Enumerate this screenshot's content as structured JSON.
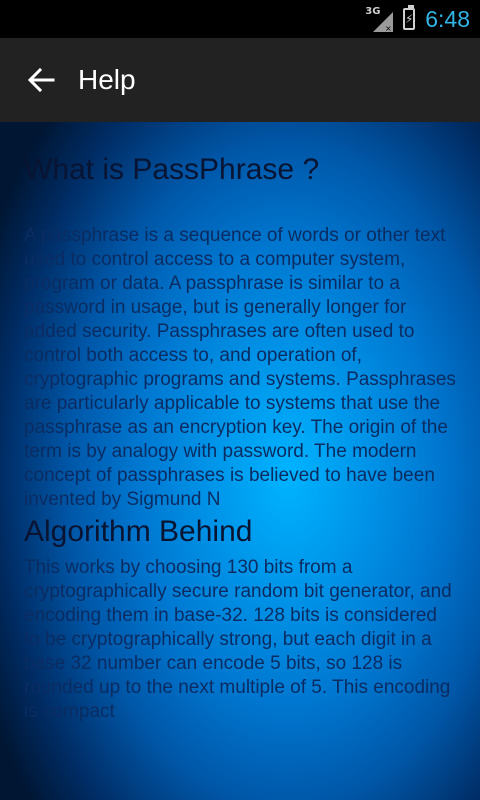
{
  "status_bar": {
    "network_label": "3G",
    "time": "6:48",
    "time_color": "#33b5e5",
    "icons": [
      "signal-icon",
      "battery-charging-icon"
    ]
  },
  "action_bar": {
    "title": "Help",
    "back_icon": "arrow-left-icon",
    "background": "#222222"
  },
  "content": {
    "heading_1": "What is PassPhrase ?",
    "paragraph_1": "A passphrase is a sequence of words or other text used to control access to a computer system, program or data. A passphrase is similar to a password in usage, but is generally longer for added security. Passphrases are often used to control both access to, and operation of, cryptographic programs and systems. Passphrases are particularly applicable to systems that use the passphrase as an encryption key. The origin of the term is by analogy with password. The modern concept of passphrases is believed to have been invented by Sigmund N",
    "heading_2": "Algorithm Behind",
    "paragraph_2": "This works by choosing 130 bits from a cryptographically secure random bit generator, and encoding them in base-32. 128 bits is considered to be cryptographically strong, but each digit in a base 32 number can encode 5 bits, so 128 is rounded up to the next multiple of 5. This encoding is compact",
    "background_accent": "#00b4ff",
    "text_color": "#0b2c62"
  }
}
